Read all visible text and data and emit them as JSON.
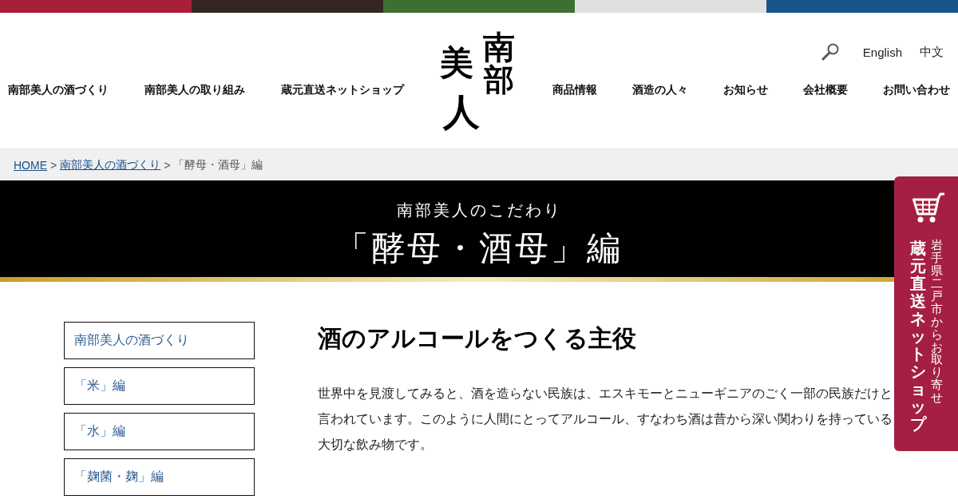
{
  "top_bar": [
    {
      "color": "#a82038"
    },
    {
      "color": "#332623"
    },
    {
      "color": "#3c7033"
    },
    {
      "color": "#e0e0e0"
    },
    {
      "color": "#17558c"
    }
  ],
  "header": {
    "logo": "南部美人",
    "nav_left": [
      "南部美人の酒づくり",
      "南部美人の取り組み",
      "蔵元直送ネットショップ"
    ],
    "languages": [
      "English",
      "中文"
    ],
    "nav_right": [
      "商品情報",
      "酒造の人々",
      "お知らせ",
      "会社概要",
      "お問い合わせ"
    ]
  },
  "breadcrumb": {
    "separator": ">",
    "items": [
      {
        "label": "HOME",
        "current": false
      },
      {
        "label": "南部美人の酒づくり",
        "current": false
      },
      {
        "label": "「酵母・酒母」編",
        "current": true
      }
    ]
  },
  "banner": {
    "subtitle": "南部美人のこだわり",
    "title": "「酵母・酒母」編"
  },
  "sidebar": {
    "items": [
      "南部美人の酒づくり",
      "「米」編",
      "「水」編",
      "「麹菌・麹」編"
    ]
  },
  "article": {
    "heading": "酒のアルコールをつくる主役",
    "paragraph": "世界中を見渡してみると、酒を造らない民族は、エスキモーとニューギニアのごく一部の民族だけと言われています。このように人間にとってアルコール、すなわち酒は昔から深い関わりを持っている大切な飲み物です。"
  },
  "shop_tab": {
    "title": "蔵元直送ネットショップ",
    "subtitle": "岩手県二戸市からお取り寄せ"
  }
}
